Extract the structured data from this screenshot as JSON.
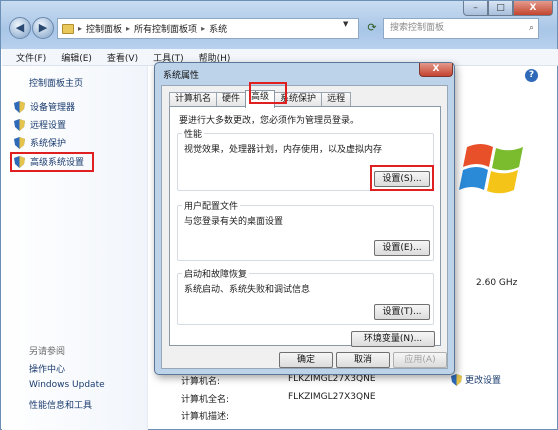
{
  "window": {
    "address": {
      "path": [
        "控制面板",
        "所有控制面板项",
        "系统"
      ]
    },
    "search_placeholder": "搜索控制面板",
    "controls": {
      "min": "–",
      "max": "□",
      "close": "X"
    }
  },
  "menubar": [
    "文件(F)",
    "编辑(E)",
    "查看(V)",
    "工具(T)",
    "帮助(H)"
  ],
  "leftnav": {
    "home": "控制面板主页",
    "items": [
      "设备管理器",
      "远程设置",
      "系统保护",
      "高级系统设置"
    ],
    "see_also": "另请参阅",
    "links": [
      "操作中心",
      "Windows Update",
      "性能信息和工具"
    ]
  },
  "content": {
    "cpu_speed": "2.60 GHz",
    "info": [
      {
        "label": "计算机名:",
        "value": "FLKZIMGL27X3QNE"
      },
      {
        "label": "计算机全名:",
        "value": "FLKZIMGL27X3QNE"
      },
      {
        "label": "计算机描述:",
        "value": ""
      }
    ],
    "change_settings": "更改设置"
  },
  "dialog": {
    "title": "系统属性",
    "close": "X",
    "tabs": [
      "计算机名",
      "硬件",
      "高级",
      "系统保护",
      "远程"
    ],
    "active_tab": "高级",
    "notice": "要进行大多数更改，您必须作为管理员登录。",
    "groups": [
      {
        "title": "性能",
        "desc": "视觉效果，处理器计划，内存使用，以及虚拟内存",
        "button": "设置(S)..."
      },
      {
        "title": "用户配置文件",
        "desc": "与您登录有关的桌面设置",
        "button": "设置(E)..."
      },
      {
        "title": "启动和故障恢复",
        "desc": "系统启动、系统失败和调试信息",
        "button": "设置(T)..."
      }
    ],
    "env_button": "环境变量(N)...",
    "ok": "确定",
    "cancel": "取消",
    "apply": "应用(A)"
  },
  "colors": {
    "highlight": "#e02020",
    "link": "#1a3b6e",
    "titlebar": "#b8d1ee"
  }
}
